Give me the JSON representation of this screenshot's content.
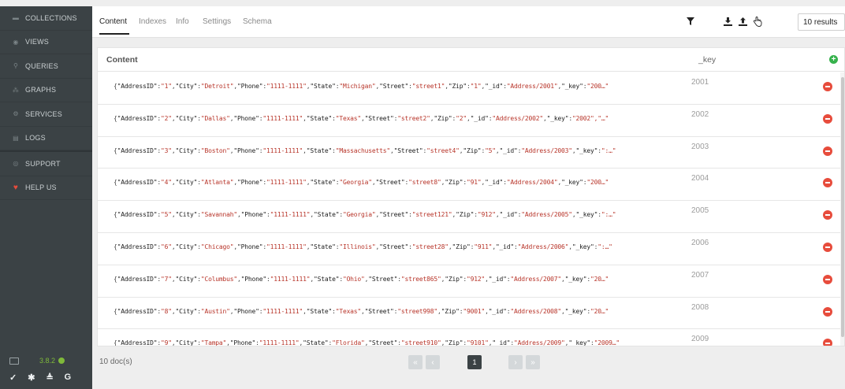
{
  "sidebar": {
    "items": [
      {
        "label": "COLLECTIONS",
        "icon": "collections-icon"
      },
      {
        "label": "VIEWS",
        "icon": "views-icon"
      },
      {
        "label": "QUERIES",
        "icon": "queries-icon"
      },
      {
        "label": "GRAPHS",
        "icon": "graphs-icon"
      },
      {
        "label": "SERVICES",
        "icon": "services-icon"
      },
      {
        "label": "LOGS",
        "icon": "logs-icon"
      },
      {
        "label": "SUPPORT",
        "icon": "support-icon"
      },
      {
        "label": "HELP US",
        "icon": "heart-icon"
      }
    ],
    "version": "3.8.2",
    "version_color": "#7fb93a"
  },
  "tabs": [
    {
      "label": "Content",
      "active": true
    },
    {
      "label": "Indexes",
      "active": false
    },
    {
      "label": "Info",
      "active": false
    },
    {
      "label": "Settings",
      "active": false
    },
    {
      "label": "Schema",
      "active": false
    }
  ],
  "toolbar": {
    "icons": [
      "filter-icon",
      "download-icon",
      "upload-icon",
      "select-hand-icon"
    ],
    "results": "10 results"
  },
  "table": {
    "header_content": "Content",
    "header_key": "_key",
    "rows": [
      {
        "doc": [
          [
            "AddressID",
            "1"
          ],
          [
            "City",
            "Detroit"
          ],
          [
            "Phone",
            "1111-1111"
          ],
          [
            "State",
            "Michigan"
          ],
          [
            "Street",
            "street1"
          ],
          [
            "Zip",
            "1"
          ],
          [
            "_id",
            "Address/2001"
          ],
          [
            "_key",
            "200…"
          ]
        ],
        "key": "2001"
      },
      {
        "doc": [
          [
            "AddressID",
            "2"
          ],
          [
            "City",
            "Dallas"
          ],
          [
            "Phone",
            "1111-1111"
          ],
          [
            "State",
            "Texas"
          ],
          [
            "Street",
            "street2"
          ],
          [
            "Zip",
            "2"
          ],
          [
            "_id",
            "Address/2002"
          ],
          [
            "_key",
            "2002\",\"…"
          ]
        ],
        "key": "2002"
      },
      {
        "doc": [
          [
            "AddressID",
            "3"
          ],
          [
            "City",
            "Boston"
          ],
          [
            "Phone",
            "1111-1111"
          ],
          [
            "State",
            "Massachusetts"
          ],
          [
            "Street",
            "street4"
          ],
          [
            "Zip",
            "5"
          ],
          [
            "_id",
            "Address/2003"
          ],
          [
            "_key",
            ":…"
          ]
        ],
        "key": "2003"
      },
      {
        "doc": [
          [
            "AddressID",
            "4"
          ],
          [
            "City",
            "Atlanta"
          ],
          [
            "Phone",
            "1111-1111"
          ],
          [
            "State",
            "Georgia"
          ],
          [
            "Street",
            "street8"
          ],
          [
            "Zip",
            "91"
          ],
          [
            "_id",
            "Address/2004"
          ],
          [
            "_key",
            "200…"
          ]
        ],
        "key": "2004"
      },
      {
        "doc": [
          [
            "AddressID",
            "5"
          ],
          [
            "City",
            "Savannah"
          ],
          [
            "Phone",
            "1111-1111"
          ],
          [
            "State",
            "Georgia"
          ],
          [
            "Street",
            "street121"
          ],
          [
            "Zip",
            "912"
          ],
          [
            "_id",
            "Address/2005"
          ],
          [
            "_key",
            ":…"
          ]
        ],
        "key": "2005"
      },
      {
        "doc": [
          [
            "AddressID",
            "6"
          ],
          [
            "City",
            "Chicago"
          ],
          [
            "Phone",
            "1111-1111"
          ],
          [
            "State",
            "Illinois"
          ],
          [
            "Street",
            "street28"
          ],
          [
            "Zip",
            "911"
          ],
          [
            "_id",
            "Address/2006"
          ],
          [
            "_key",
            ":…"
          ]
        ],
        "key": "2006"
      },
      {
        "doc": [
          [
            "AddressID",
            "7"
          ],
          [
            "City",
            "Columbus"
          ],
          [
            "Phone",
            "1111-1111"
          ],
          [
            "State",
            "Ohio"
          ],
          [
            "Street",
            "street865"
          ],
          [
            "Zip",
            "912"
          ],
          [
            "_id",
            "Address/2007"
          ],
          [
            "_key",
            "20…"
          ]
        ],
        "key": "2007"
      },
      {
        "doc": [
          [
            "AddressID",
            "8"
          ],
          [
            "City",
            "Austin"
          ],
          [
            "Phone",
            "1111-1111"
          ],
          [
            "State",
            "Texas"
          ],
          [
            "Street",
            "street998"
          ],
          [
            "Zip",
            "9001"
          ],
          [
            "_id",
            "Address/2008"
          ],
          [
            "_key",
            "20…"
          ]
        ],
        "key": "2008"
      },
      {
        "doc": [
          [
            "AddressID",
            "9"
          ],
          [
            "City",
            "Tampa"
          ],
          [
            "Phone",
            "1111-1111"
          ],
          [
            "State",
            "Florida"
          ],
          [
            "Street",
            "street910"
          ],
          [
            "Zip",
            "9101"
          ],
          [
            "_id",
            "Address/2009"
          ],
          [
            "_key",
            "2009…"
          ]
        ],
        "key": "2009"
      }
    ]
  },
  "footer": {
    "doc_count": "10 doc(s)",
    "pager": [
      "«",
      "‹",
      "1",
      "›",
      "»"
    ],
    "current_page": "1"
  }
}
